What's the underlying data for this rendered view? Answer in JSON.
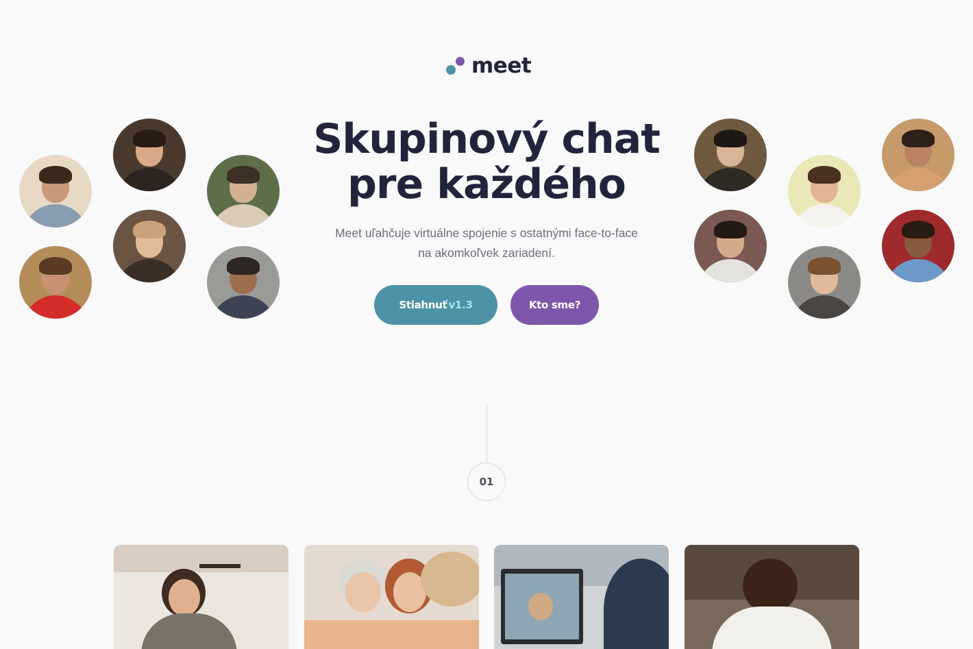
{
  "brand": {
    "name": "meet",
    "colors": {
      "teal": "#4e93a6",
      "purple": "#7d59a8",
      "dark": "#22243c"
    }
  },
  "hero": {
    "title_line1": "Skupinový chat",
    "title_line2": "pre každého",
    "subtitle": "Meet uľahčuje virtuálne spojenie s ostatnými face-to-face na akomkoľvek zariadení.",
    "download_label": "Stiahnuť",
    "download_version": "v1.3",
    "about_label": "Kto sme?"
  },
  "section": {
    "step_number": "01"
  },
  "avatars_left": [
    {
      "name": "avatar-young-man",
      "bg": "#e8d9c6",
      "skin": "#c99a7a",
      "hair": "#3a2a1e",
      "shirt": "#8a9db0"
    },
    {
      "name": "avatar-smiling-woman",
      "bg": "#4a3a2e",
      "skin": "#d8a888",
      "hair": "#2a1c14",
      "shirt": "#2d2420"
    },
    {
      "name": "avatar-man-jacket",
      "bg": "#5e6e4a",
      "skin": "#d4b092",
      "hair": "#3d3025",
      "shirt": "#d9cbb8"
    },
    {
      "name": "avatar-blonde-woman",
      "bg": "#6a5444",
      "skin": "#e2bc98",
      "hair": "#c9a27a",
      "shirt": "#3a2e26"
    },
    {
      "name": "avatar-bearded-man",
      "bg": "#b48c5a",
      "skin": "#c69272",
      "hair": "#5a3a22",
      "shirt": "#d52c2c"
    },
    {
      "name": "avatar-older-man",
      "bg": "#9a9a96",
      "skin": "#9e6e50",
      "hair": "#2e2622",
      "shirt": "#3e4454"
    }
  ],
  "avatars_right": [
    {
      "name": "avatar-man-sunglasses",
      "bg": "#6e5a40",
      "skin": "#d8b498",
      "hair": "#1e1814",
      "shirt": "#2e2a24"
    },
    {
      "name": "avatar-laughing-man",
      "bg": "#e9e8b6",
      "skin": "#e0b494",
      "hair": "#4a3222",
      "shirt": "#f4f2ec"
    },
    {
      "name": "avatar-couple",
      "bg": "#c69a6a",
      "skin": "#b98262",
      "hair": "#2e2018",
      "shirt": "#d4a070"
    },
    {
      "name": "avatar-man-blossoms",
      "bg": "#7a5a52",
      "skin": "#d2aa8a",
      "hair": "#241a14",
      "shirt": "#e4e2de"
    },
    {
      "name": "avatar-curly-man",
      "bg": "#8c8a86",
      "skin": "#e0b89a",
      "hair": "#7a5232",
      "shirt": "#4a4644"
    },
    {
      "name": "avatar-woman-red-wall",
      "bg": "#9e2a2e",
      "skin": "#8a5a3e",
      "hair": "#2a1c14",
      "shirt": "#6e9ac8"
    }
  ],
  "cards": [
    {
      "name": "card-woman-kitchen",
      "bg": "#ece6de"
    },
    {
      "name": "card-women-phone",
      "bg": "#e4dad0"
    },
    {
      "name": "card-video-call",
      "bg": "#cfd3d6"
    },
    {
      "name": "card-man-reading",
      "bg": "#7a6a5c"
    }
  ]
}
